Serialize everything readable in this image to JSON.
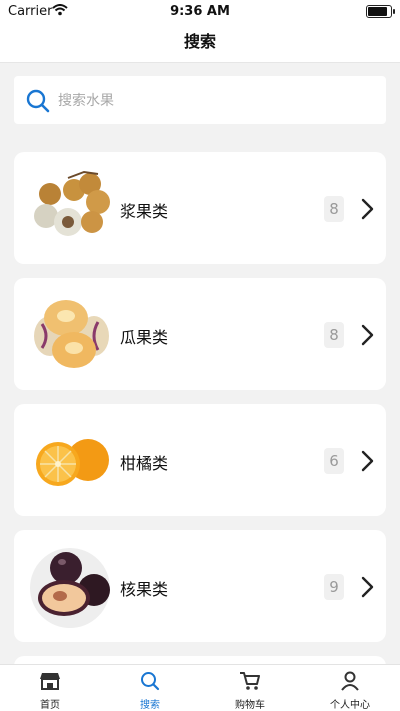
{
  "status_bar": {
    "carrier": "Carrier",
    "time": "9:36 AM"
  },
  "nav": {
    "title": "搜索"
  },
  "search": {
    "placeholder": "搜索水果"
  },
  "categories": [
    {
      "name": "浆果类",
      "count": "8",
      "image": "longan-fruit-photo"
    },
    {
      "name": "瓜果类",
      "count": "8",
      "image": "pepino-melon-photo"
    },
    {
      "name": "柑橘类",
      "count": "6",
      "image": "orange-photo"
    },
    {
      "name": "核果类",
      "count": "9",
      "image": "plum-photo"
    }
  ],
  "tabs": [
    {
      "label": "首页",
      "icon": "store-icon",
      "active": false
    },
    {
      "label": "搜索",
      "icon": "search-icon",
      "active": true
    },
    {
      "label": "购物车",
      "icon": "cart-icon",
      "active": false
    },
    {
      "label": "个人中心",
      "icon": "person-icon",
      "active": false
    }
  ],
  "colors": {
    "accent": "#1976d2",
    "background": "#f2f2f2",
    "card": "#ffffff"
  }
}
